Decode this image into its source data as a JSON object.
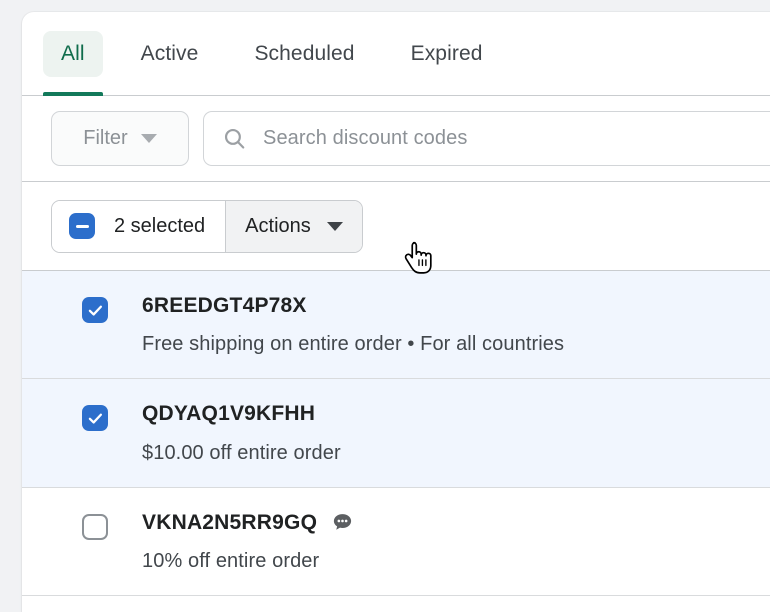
{
  "tabs": [
    {
      "label": "All",
      "active": true
    },
    {
      "label": "Active",
      "active": false
    },
    {
      "label": "Scheduled",
      "active": false
    },
    {
      "label": "Expired",
      "active": false
    }
  ],
  "filters": {
    "filter_button_label": "Filter",
    "filter_caret_icon": "chevron-down-icon",
    "search_icon": "search-icon",
    "search_placeholder": "Search discount codes",
    "search_value": ""
  },
  "bulk_actions": {
    "select_all_state": "indeterminate",
    "selected_label": "2 selected",
    "selected_count": 2,
    "actions_label": "Actions",
    "actions_caret_icon": "chevron-down-icon"
  },
  "list": {
    "rows": [
      {
        "code": "6REEDGT4P78X",
        "description": "Free shipping on entire order • For all countries",
        "selected": true,
        "has_comment_icon": false
      },
      {
        "code": "QDYAQ1V9KFHH",
        "description": "$10.00 off entire order",
        "selected": true,
        "has_comment_icon": false
      },
      {
        "code": "VKNA2N5RR9GQ",
        "description": "10% off entire order",
        "selected": false,
        "has_comment_icon": true,
        "comment_icon": "comment-bubble-icon"
      }
    ]
  },
  "cursor": {
    "icon": "pointer-hand-cursor"
  },
  "colors": {
    "accent_green": "#12795a",
    "accent_green_text": "#0f6c4b",
    "accent_green_bg": "#edf3f0",
    "checkbox_blue": "#2c6ecb",
    "selected_row_bg": "#f1f6fe",
    "page_bg": "#f1f2f4",
    "border": "#c9cccf",
    "text_primary": "#202223",
    "text_subdued": "#8c9196"
  }
}
